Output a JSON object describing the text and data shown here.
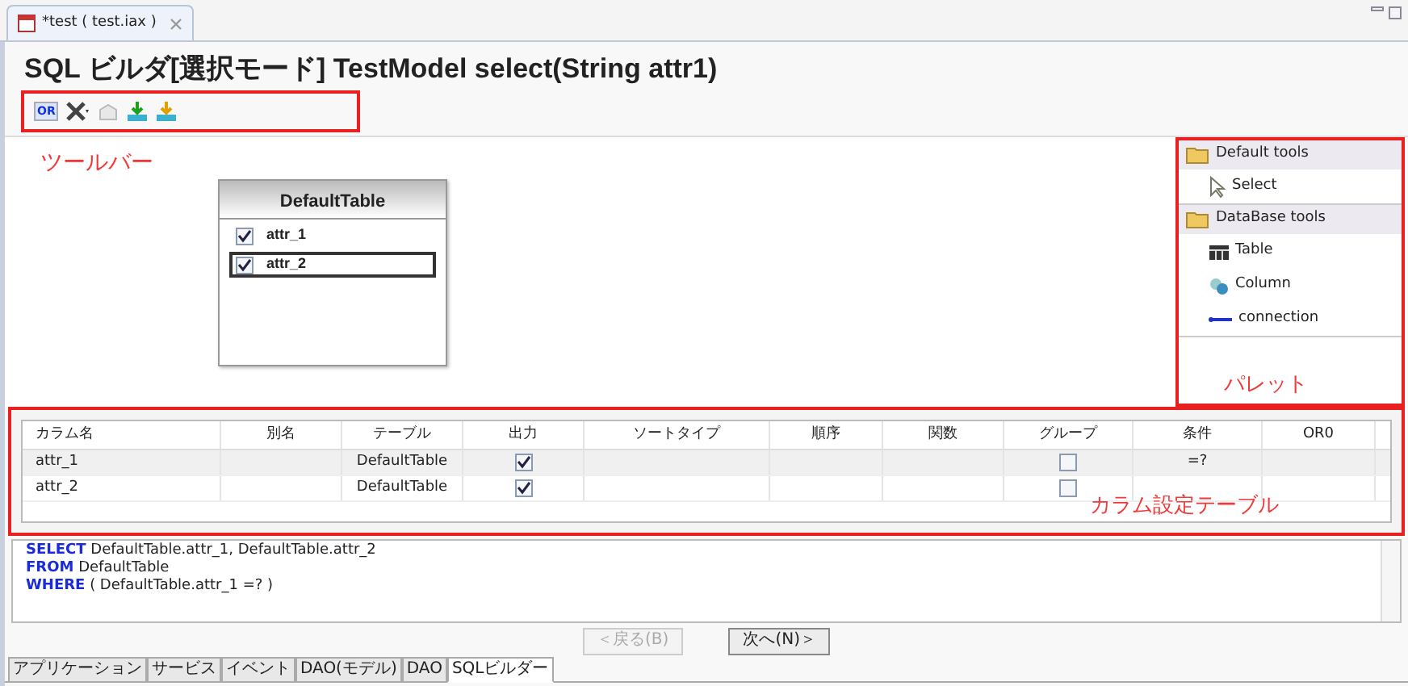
{
  "editor_tab": {
    "title": "*test ( test.iax )",
    "selected": true
  },
  "heading": "SQL ビルダ[選択モード] TestModel select(String attr1)",
  "annotations": [
    {
      "kind": "toolbar",
      "label": "ツールバー"
    },
    {
      "kind": "palette",
      "label": "パレット"
    },
    {
      "kind": "table",
      "label": "カラム設定テーブル"
    }
  ],
  "diagram_table": {
    "title": "DefaultTable",
    "attributes": [
      {
        "name": "attr_1",
        "checked": true,
        "selected": false
      },
      {
        "name": "attr_2",
        "checked": true,
        "selected": true
      }
    ]
  },
  "palette": {
    "groups": [
      {
        "title": "Default tools",
        "items": [
          {
            "kind": "arrow",
            "label": "Select"
          }
        ]
      },
      {
        "title": "DataBase tools",
        "items": [
          {
            "kind": "table",
            "label": "Table"
          },
          {
            "kind": "column",
            "label": "Column"
          },
          {
            "kind": "line",
            "label": "connection"
          }
        ]
      }
    ]
  },
  "toolbar_or_label": "OR",
  "columns": [
    "カラム名",
    "別名",
    "テーブル",
    "出力",
    "ソートタイプ",
    "順序",
    "関数",
    "グループ",
    "条件",
    "OR0"
  ],
  "rows": [
    {
      "name": "attr_1",
      "table": "DefaultTable",
      "output": true,
      "group": false,
      "condition": "=?"
    },
    {
      "name": "attr_2",
      "table": "DefaultTable",
      "output": true,
      "group": false
    }
  ],
  "sql_lines": [
    {
      "keyword": "SELECT",
      "text": "DefaultTable.attr_1, DefaultTable.attr_2"
    },
    {
      "keyword": "FROM",
      "text": "DefaultTable"
    },
    {
      "keyword": "WHERE",
      "text": "( DefaultTable.attr_1 =? )"
    }
  ],
  "buttons": [
    {
      "label": "＜戻る(B)",
      "disabled": true
    },
    {
      "label": "次へ(N)＞",
      "disabled": false
    }
  ],
  "bottom_tabs": [
    {
      "label": "アプリケーション",
      "selected": false
    },
    {
      "label": "サービス",
      "selected": false
    },
    {
      "label": "イベント",
      "selected": false
    },
    {
      "label": "DAO(モデル)",
      "selected": false
    },
    {
      "label": "DAO",
      "selected": false
    },
    {
      "label": "SQLビルダー",
      "selected": true
    }
  ]
}
